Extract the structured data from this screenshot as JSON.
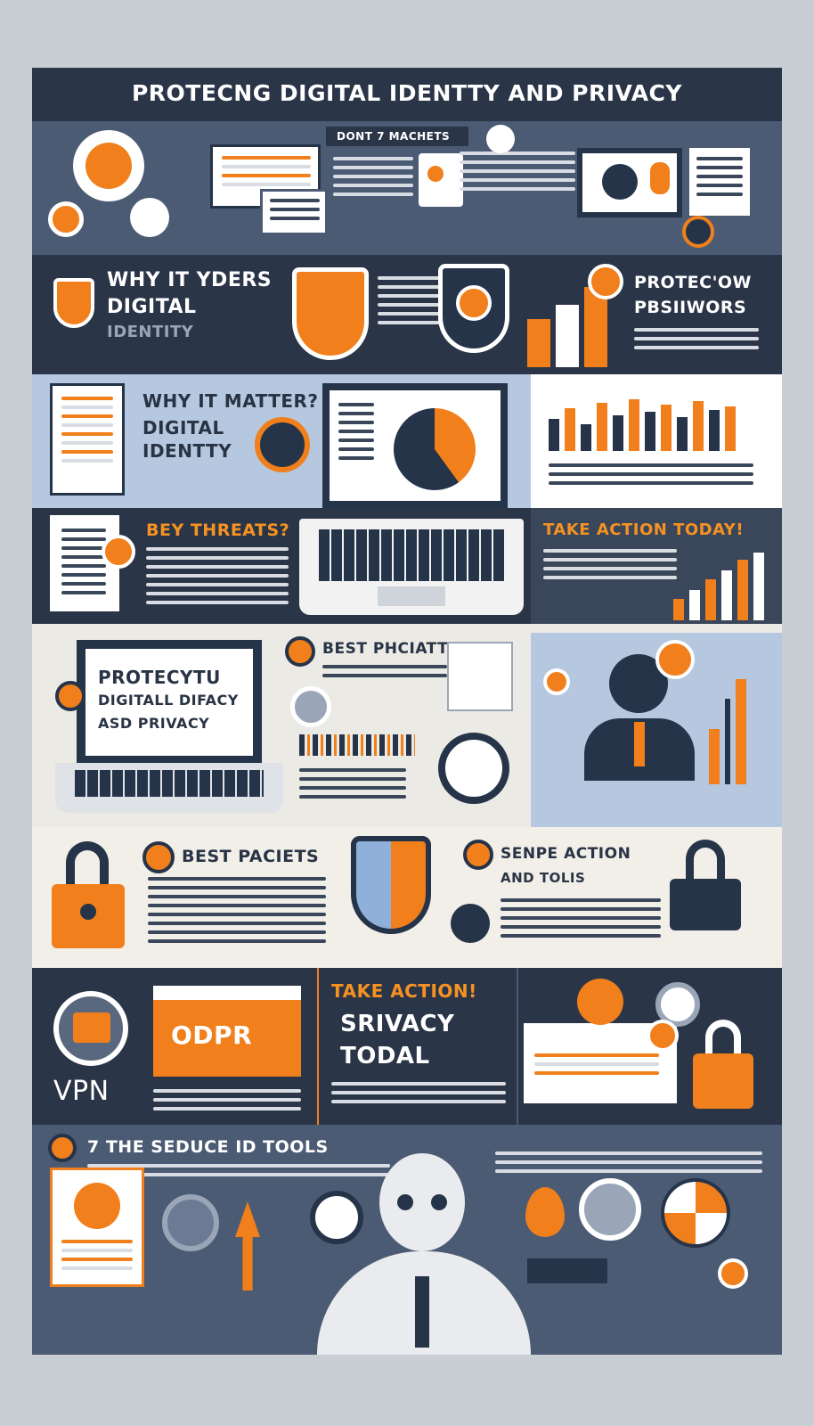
{
  "title": "PROTECNG DIGITAL IDENTTY AND PRIVACY",
  "band1": {
    "tag": "DONT 7 MACHETS"
  },
  "band2": {
    "left_heading": [
      "WHY IT YDERS",
      "DIGITAL",
      "IDENTITY"
    ],
    "right_heading": [
      "PROTEC'OW",
      "PBSIIWORS"
    ]
  },
  "band3": {
    "heading": [
      "WHY IT MATTER?",
      "DIGITAL",
      "IDENTTY"
    ]
  },
  "band4": {
    "threats": "BEY THREATS?",
    "action": "TAKE ACTION TODAY!"
  },
  "band5": {
    "screen": [
      "PROTECYTU",
      "DIGITALL DIFACY",
      "ASD PRIVACY"
    ],
    "heading": "BEST PHCIATTS"
  },
  "band6": {
    "left": "BEST PACIETS",
    "right": [
      "SENPE ACTION",
      "AND TOLIS"
    ]
  },
  "band7": {
    "vpn": "VPN",
    "gdpr": "ODPR",
    "take": "TAKE ACTION!",
    "srivacy": "SRIVACY",
    "today": "TODAL"
  },
  "band8": {
    "heading": "7 THE SEDUCE ID TOOLS"
  },
  "colors": {
    "accent": "#f07f1c",
    "navy": "#26344a",
    "slate": "#4b5b74"
  }
}
